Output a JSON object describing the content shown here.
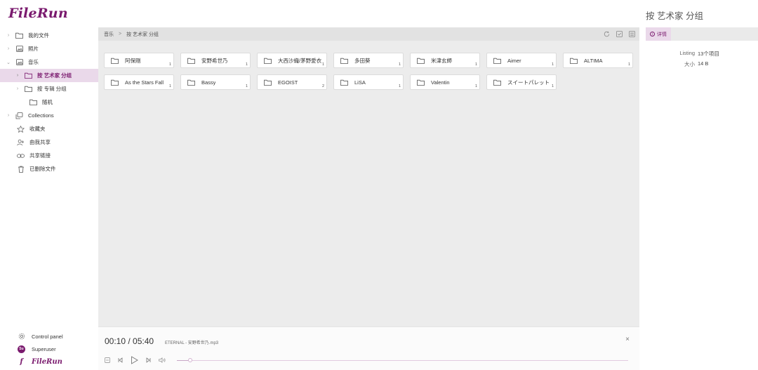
{
  "app": {
    "logo_text": "FileRun"
  },
  "sidebar": {
    "items": [
      {
        "label": "我的文件",
        "icon": "folder-icon"
      },
      {
        "label": "照片",
        "icon": "image-icon"
      },
      {
        "label": "音乐",
        "icon": "image-icon"
      },
      {
        "label": "按 艺术家 分组",
        "icon": "folder-icon"
      },
      {
        "label": "按 专辑 分组",
        "icon": "folder-icon"
      },
      {
        "label": "随机",
        "icon": "folder-icon"
      },
      {
        "label": "Collections",
        "icon": "collections-icon"
      },
      {
        "label": "收藏夹",
        "icon": "star-icon"
      },
      {
        "label": "由我共享",
        "icon": "user-share-icon"
      },
      {
        "label": "共享链接",
        "icon": "link-icon"
      },
      {
        "label": "已删除文件",
        "icon": "trash-icon"
      }
    ],
    "bottom": {
      "control_panel": "Control panel",
      "user": "Superuser",
      "avatar_initials": "Su",
      "footer_logo": "FileRun"
    }
  },
  "breadcrumb": {
    "root": "音乐",
    "separator": ">",
    "current": "按 艺术家 分组"
  },
  "folders": [
    {
      "name": "阿保剛",
      "count": "1"
    },
    {
      "name": "安野希世乃",
      "count": "1"
    },
    {
      "name": "大西沙織/茅野愛衣",
      "count": "1"
    },
    {
      "name": "多田葵",
      "count": "1"
    },
    {
      "name": "米津玄師",
      "count": "1"
    },
    {
      "name": "Aimer",
      "count": "1"
    },
    {
      "name": "ALTIMA",
      "count": "1"
    },
    {
      "name": "As the Stars Fall",
      "count": "1"
    },
    {
      "name": "Bassy",
      "count": "1"
    },
    {
      "name": "EGOIST",
      "count": "2"
    },
    {
      "name": "LiSA",
      "count": "1"
    },
    {
      "name": "Valentin",
      "count": "1"
    },
    {
      "name": "スイートパレット",
      "count": "1"
    }
  ],
  "player": {
    "time": "00:10 / 05:40",
    "track": "ETERNAL - 安野希世乃.mp3",
    "close": "×",
    "progress_fraction": 0.03
  },
  "details": {
    "title": "按 艺术家 分组",
    "tab_label": "详情",
    "listing_key": "Listing",
    "listing_value": "13个项目",
    "size_key": "大小",
    "size_value": "14 B"
  },
  "colors": {
    "accent": "#7a1a6e",
    "active_bg": "#ead9ea",
    "main_bg": "#ececec"
  }
}
